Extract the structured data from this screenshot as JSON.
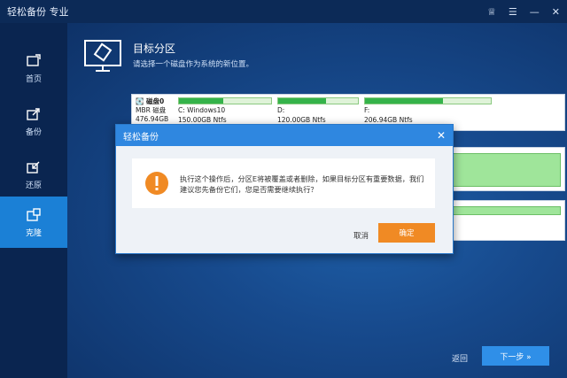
{
  "window": {
    "title": "轻松备份 专业",
    "controls": {
      "pin": "♕",
      "menu": "☰",
      "minimize": "—",
      "close": "✕"
    }
  },
  "sidebar": {
    "items": [
      {
        "label": "首页",
        "icon": "home-icon"
      },
      {
        "label": "备份",
        "icon": "backup-icon"
      },
      {
        "label": "还原",
        "icon": "restore-icon"
      },
      {
        "label": "克隆",
        "icon": "clone-icon",
        "active": true
      }
    ]
  },
  "header": {
    "title": "目标分区",
    "subtitle": "请选择一个磁盘作为系统的新位置。"
  },
  "disk": {
    "name": "磁盘0",
    "type": "MBR 磁盘",
    "size": "476.94GB",
    "partitions": [
      {
        "label": "C: Windows10",
        "detail": "150.00GB Ntfs",
        "used_fraction": 0.48
      },
      {
        "label": "D:",
        "detail": "120.00GB Ntfs",
        "used_fraction": 0.6
      },
      {
        "label": "F:",
        "detail": "206.94GB Ntfs",
        "used_fraction": 0.62
      }
    ]
  },
  "footer": {
    "back": "返回",
    "next": "下一步 »"
  },
  "dialog": {
    "title": "轻松备份",
    "close": "✕",
    "message": "执行这个操作后，分区E将被覆盖或者删除，如果目标分区有重要数据，我们建议您先备份它们，您是否需要继续执行？",
    "cancel": "取消",
    "ok": "确定"
  },
  "colors": {
    "accent": "#1b80d6",
    "ok_button": "#f08a24",
    "warning": "#f08a24",
    "partition_used": "#35b34a"
  }
}
